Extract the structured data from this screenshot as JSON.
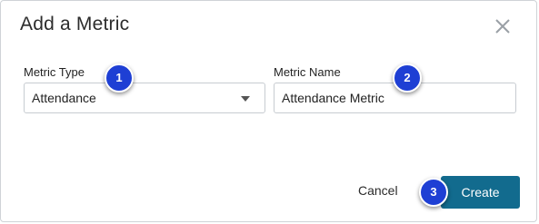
{
  "dialog": {
    "title": "Add a Metric",
    "close_icon": "close-icon"
  },
  "metric_type": {
    "label": "Metric Type",
    "value": "Attendance"
  },
  "metric_name": {
    "label": "Metric Name",
    "value": "Attendance Metric"
  },
  "footer": {
    "cancel_label": "Cancel",
    "create_label": "Create"
  },
  "badges": [
    "1",
    "2",
    "3"
  ],
  "colors": {
    "primary": "#126b8e",
    "badge": "#1e3fd4"
  }
}
